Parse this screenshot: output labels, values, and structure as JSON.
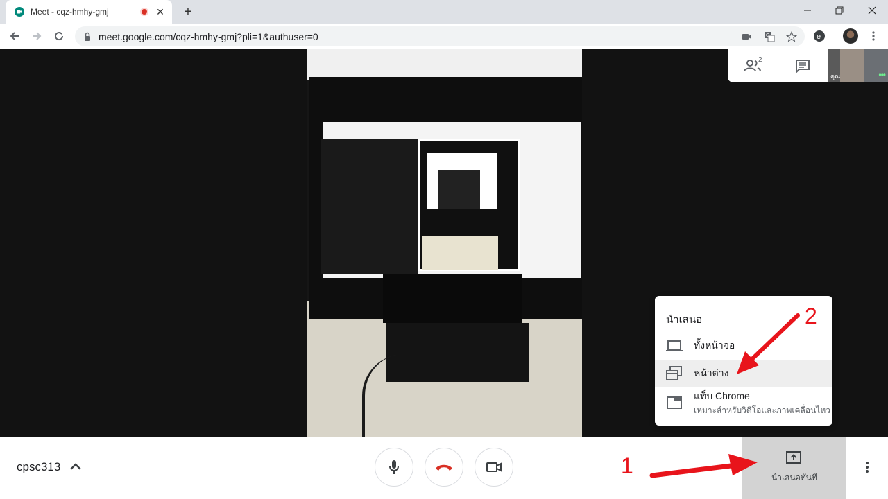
{
  "browser": {
    "tab_title": "Meet - cqz-hmhy-gmj",
    "url": "meet.google.com/cqz-hmhy-gmj?pli=1&authuser=0"
  },
  "meet": {
    "participant_count": "2",
    "self_label": "คุณ",
    "meeting_name": "cpsc313",
    "present_button_label": "นำเสนอทันที"
  },
  "present_menu": {
    "title": "นำเสนอ",
    "items": [
      {
        "label": "ทั้งหน้าจอ",
        "icon": "laptop-icon"
      },
      {
        "label": "หน้าต่าง",
        "icon": "window-icon"
      },
      {
        "label": "แท็บ Chrome",
        "sublabel": "เหมาะสำหรับวิดีโอและภาพเคลื่อนไหว",
        "icon": "tab-icon"
      }
    ]
  },
  "annotations": {
    "step1": "1",
    "step2": "2",
    "color": "#e8141b"
  },
  "colors": {
    "present_bg": "#d3d3d3",
    "hangup_red": "#d93025",
    "menu_hover": "#eeeeee"
  }
}
